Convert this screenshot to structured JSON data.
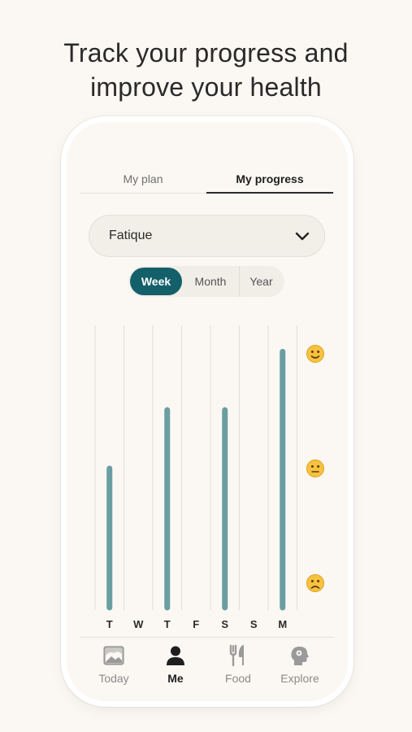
{
  "headline": {
    "line1": "Track your progress and",
    "line2": "improve your health"
  },
  "tabs": [
    {
      "label": "My plan",
      "active": false
    },
    {
      "label": "My progress",
      "active": true
    }
  ],
  "symptom_select": {
    "selected": "Fatique"
  },
  "period": {
    "options": [
      "Week",
      "Month",
      "Year"
    ],
    "selected": "Week"
  },
  "chart_data": {
    "type": "bar",
    "categories": [
      "T",
      "W",
      "T",
      "F",
      "S",
      "S",
      "M"
    ],
    "values": [
      0.5,
      null,
      0.71,
      null,
      0.71,
      null,
      0.92
    ],
    "ylim": [
      0,
      1
    ],
    "y_scale_icons": [
      "slight-smile-emoji-icon",
      "neutral-face-emoji-icon",
      "slight-frown-emoji-icon"
    ],
    "bar_color": "#6a9ea3"
  },
  "bottom_nav": [
    {
      "label": "Today",
      "icon": "image-icon",
      "active": false
    },
    {
      "label": "Me",
      "icon": "person-icon",
      "active": true
    },
    {
      "label": "Food",
      "icon": "fork-knife-icon",
      "active": false
    },
    {
      "label": "Explore",
      "icon": "head-gears-icon",
      "active": false
    }
  ],
  "colors": {
    "accent": "#14606a",
    "background": "#fbf7f2",
    "bar": "#6a9ea3"
  }
}
